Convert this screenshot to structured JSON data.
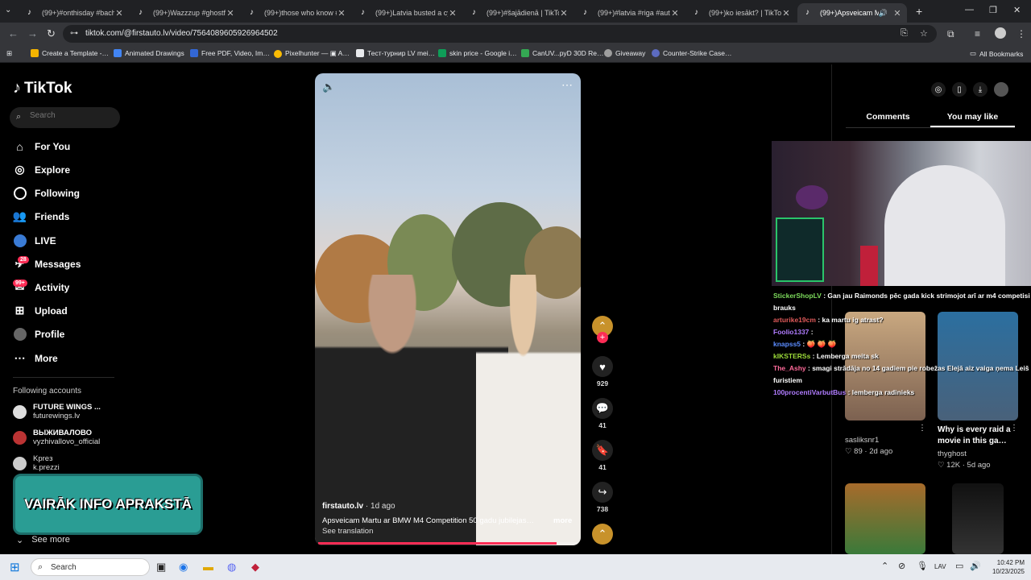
{
  "browser": {
    "tabs": [
      {
        "title": "(99+)#onthisday #bacha…",
        "active": false
      },
      {
        "title": "(99+)Wazzzup #ghostfac…",
        "active": false
      },
      {
        "title": "(99+)those who know #fy…",
        "active": false
      },
      {
        "title": "(99+)Latvia busted a cybe…",
        "active": false
      },
      {
        "title": "(99+)#šajādienā | TikTok",
        "active": false
      },
      {
        "title": "(99+)#latvia #riga #autun…",
        "active": false
      },
      {
        "title": "(99+)ko iesākt? | TikTok",
        "active": false
      },
      {
        "title": "(99+)Apsveicam Mar…",
        "active": true
      }
    ],
    "url": "tiktok.com/@firstauto.lv/video/7564089605926964502",
    "bookmarks": [
      {
        "label": "Create a Template -…",
        "color": "#f4b400"
      },
      {
        "label": "Animated Drawings",
        "color": "#4285f4"
      },
      {
        "label": "Free PDF, Video, Im…",
        "color": "#3367d6"
      },
      {
        "label": "Pixelhunter — ▣ A…",
        "color": "#fbbc04"
      },
      {
        "label": "Тест-турнир LV mei…",
        "color": "#e8eaed"
      },
      {
        "label": "skin price - Google i…",
        "color": "#0f9d58"
      },
      {
        "label": "CanUV...pyD 30D Re…",
        "color": "#34a853"
      },
      {
        "label": "Giveaway",
        "color": "#9e9e9e"
      },
      {
        "label": "Counter-Strike Case…",
        "color": "#5c6bc0"
      }
    ],
    "all_bookmarks": "All Bookmarks"
  },
  "sidebar": {
    "logo": "TikTok",
    "search_placeholder": "Search",
    "nav": [
      {
        "label": "For You",
        "icon": "home-icon"
      },
      {
        "label": "Explore",
        "icon": "compass-icon"
      },
      {
        "label": "Following",
        "icon": "following-icon"
      },
      {
        "label": "Friends",
        "icon": "friends-icon"
      },
      {
        "label": "LIVE",
        "icon": "live-icon"
      },
      {
        "label": "Messages",
        "icon": "messages-icon",
        "badge": "28"
      },
      {
        "label": "Activity",
        "icon": "activity-icon",
        "badge": "99+"
      },
      {
        "label": "Upload",
        "icon": "upload-icon"
      },
      {
        "label": "Profile",
        "icon": "profile-icon"
      },
      {
        "label": "More",
        "icon": "more-icon"
      }
    ],
    "following_title": "Following accounts",
    "accounts": [
      {
        "name": "FUTURE WINGS ...",
        "handle": "futurewings.lv"
      },
      {
        "name": "ВЫЖИВАЛОВО",
        "handle": "vyzhivallovo_official"
      },
      {
        "name": "Kpreз",
        "handle": "k.prezzi"
      }
    ],
    "see_more": "See more",
    "banner_text": "VAIRĀK INFO APRAKSTĀ"
  },
  "video": {
    "author": "firstauto.lv",
    "age": " · 1d ago",
    "caption": "Apsveicam Martu ar BMW M4 Competition 50 gadu jubilejas…",
    "more": "more",
    "translate": "See translation",
    "progress": 0.92
  },
  "actions": {
    "likes": "929",
    "comments": "41",
    "saves": "41",
    "shares": "738"
  },
  "right_panel": {
    "tabs": [
      "Comments",
      "You may like"
    ],
    "active_tab": "You may like",
    "items": [
      {
        "title": "",
        "author": "sasliksnr1",
        "likes": "89",
        "age": "2d ago"
      },
      {
        "title": "Why is every raid a movie in this ga…",
        "author": "thyghost",
        "likes": "12K",
        "age": "5d ago"
      }
    ]
  },
  "chat": [
    {
      "user": "StickerShopLV",
      "color": "#7ddb5c",
      "text": "Gan jau Raimonds pēc gada kick strimojot arī ar m4 competisi brauks"
    },
    {
      "user": "arturike19cm",
      "color": "#e05a5a",
      "text": "ka martu ig atrast?"
    },
    {
      "user": "Foolio1337",
      "color": "#b07cff",
      "text": ""
    },
    {
      "user": "knapss5",
      "color": "#5b8cff",
      "text": "🍑 🍑 🍑"
    },
    {
      "user": "kIKSTERSs",
      "color": "#9ddc3a",
      "text": "Lemberga meita sk"
    },
    {
      "user": "The_Ashy",
      "color": "#ff6a9a",
      "text": "smagi strādāja no 14 gadiem pie robežas Elejā aiz vaiga ņema Leiš furistiem"
    },
    {
      "user": "100procentiVarbutBus",
      "color": "#b07cff",
      "text": "lemberga radinieks"
    }
  ],
  "taskbar": {
    "search": "Search",
    "lang": "LAV",
    "time": "10:42 PM",
    "date": "10/23/2025"
  }
}
